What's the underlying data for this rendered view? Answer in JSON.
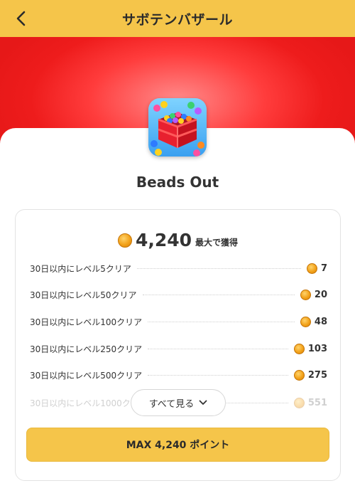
{
  "header": {
    "title": "サボテンバザール",
    "back_icon": "chevron-left-icon"
  },
  "colors": {
    "accent": "#f5c54a",
    "banner": "#ee1c1c"
  },
  "app": {
    "name": "Beads Out",
    "icon": "beads-box-app-icon"
  },
  "rewards": {
    "total": "4,240",
    "total_suffix": "最大で獲得",
    "tasks": [
      {
        "label": "30日以内にレベル5クリア",
        "points": "7"
      },
      {
        "label": "30日以内にレベル50クリア",
        "points": "20"
      },
      {
        "label": "30日以内にレベル100クリア",
        "points": "48"
      },
      {
        "label": "30日以内にレベル250クリア",
        "points": "103"
      },
      {
        "label": "30日以内にレベル500クリア",
        "points": "275"
      },
      {
        "label": "30日以内にレベル1000ク",
        "points": "551"
      }
    ],
    "see_all_label": "すべて見る",
    "max_button_label": "MAX 4,240 ポイント"
  }
}
